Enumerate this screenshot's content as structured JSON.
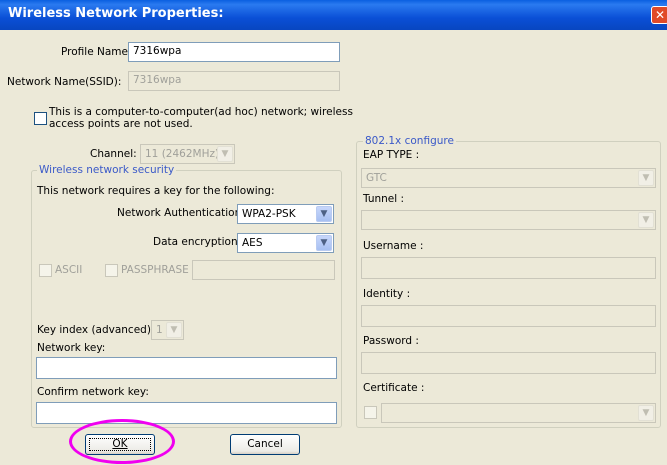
{
  "window": {
    "title": "Wireless Network Properties:",
    "close_glyph": "✕"
  },
  "profile": {
    "label": "Profile Name:",
    "value": "7316wpa"
  },
  "ssid": {
    "label": "Network Name(SSID):",
    "value": "7316wpa"
  },
  "adhoc": {
    "label_line1": "This is a computer-to-computer(ad hoc) network; wireless",
    "label_line2": "access points are not used.",
    "checked": false
  },
  "channel": {
    "label": "Channel:",
    "value": "11 (2462MHz)"
  },
  "security": {
    "legend": "Wireless network security",
    "requires_text": "This network requires a key for the following:",
    "auth_label": "Network Authentication:",
    "auth_value": "WPA2-PSK",
    "enc_label": "Data encryption:",
    "enc_value": "AES",
    "ascii_label": "ASCII",
    "passphrase_label": "PASSPHRASE",
    "passphrase_value": "",
    "key_index_label": "Key index (advanced):",
    "key_index_value": "1",
    "network_key_label": "Network key:",
    "network_key_value": "",
    "confirm_key_label": "Confirm network key:",
    "confirm_key_value": ""
  },
  "dot1x": {
    "legend": "802.1x configure",
    "eap_label": "EAP TYPE :",
    "eap_value": "GTC",
    "tunnel_label": "Tunnel :",
    "tunnel_value": "",
    "username_label": "Username :",
    "username_value": "",
    "identity_label": "Identity :",
    "identity_value": "",
    "password_label": "Password :",
    "password_value": "",
    "certificate_label": "Certificate :",
    "certificate_value": ""
  },
  "buttons": {
    "ok": "OK",
    "cancel": "Cancel"
  },
  "colors": {
    "titlebar": "#0a4fd6",
    "highlight_circle": "#f000f0",
    "group_legend": "#3a59c8"
  },
  "icons": {
    "dropdown": "chevron-down-icon",
    "close": "close-icon"
  }
}
